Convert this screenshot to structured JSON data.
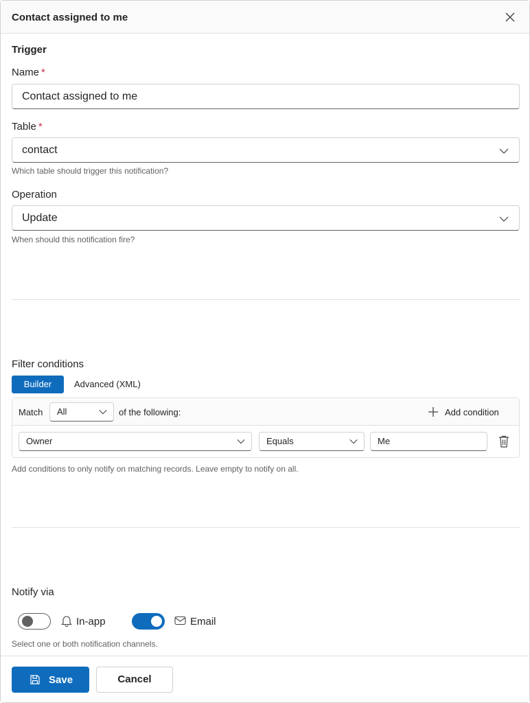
{
  "dialog": {
    "title": "Contact assigned to me"
  },
  "trigger": {
    "section_title": "Trigger",
    "name_label": "Name",
    "name_value": "Contact assigned to me",
    "required_mark": "*",
    "table_label": "Table",
    "table_value": "contact",
    "table_hint": "Which table should trigger this notification?",
    "operation_label": "Operation",
    "operation_value": "Update",
    "operation_hint": "When should this notification fire?"
  },
  "filter": {
    "section_title": "Filter conditions",
    "tabs": [
      {
        "label": "Builder",
        "active": true
      },
      {
        "label": "Advanced (XML)",
        "active": false
      }
    ],
    "match_label": "Match",
    "match_value": "All",
    "match_suffix": "of the following:",
    "add_condition_label": "Add condition",
    "condition": {
      "field": "Owner",
      "operator": "Equals",
      "value": "Me"
    },
    "hint": "Add conditions to only notify on matching records. Leave empty to notify on all."
  },
  "notify": {
    "section_title": "Notify via",
    "channels": [
      {
        "label": "In-app",
        "icon": "bell-icon",
        "enabled": false
      },
      {
        "label": "Email",
        "icon": "mail-icon",
        "enabled": true
      }
    ],
    "hint": "Select one or both notification channels."
  },
  "footer": {
    "save_label": "Save",
    "cancel_label": "Cancel"
  },
  "colors": {
    "accent": "#0f6cbd",
    "required": "#c4314b",
    "toggle_off": "#616161"
  }
}
